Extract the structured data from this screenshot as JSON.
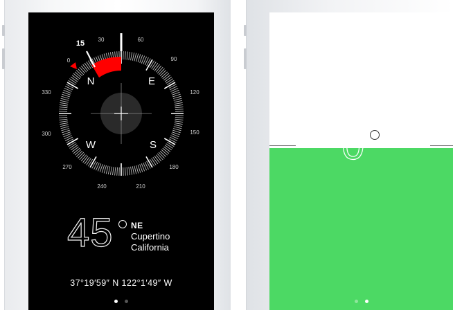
{
  "compass": {
    "heading_value": "45",
    "direction": "NE",
    "city": "Cupertino",
    "region": "California",
    "coordinates": "37°19′59″ N  122°1′49″ W",
    "bearing_marker": "15",
    "cardinals": {
      "n": "N",
      "e": "E",
      "s": "S",
      "w": "W"
    },
    "tick_labels": [
      "0",
      "30",
      "60",
      "90",
      "120",
      "150",
      "180",
      "210",
      "240",
      "270",
      "300",
      "330"
    ],
    "accent_color": "#ff0000",
    "pages": {
      "count": 2,
      "active": 1
    }
  },
  "level": {
    "value": "0",
    "fill_color": "#4cd964",
    "pages": {
      "count": 2,
      "active": 2
    }
  }
}
